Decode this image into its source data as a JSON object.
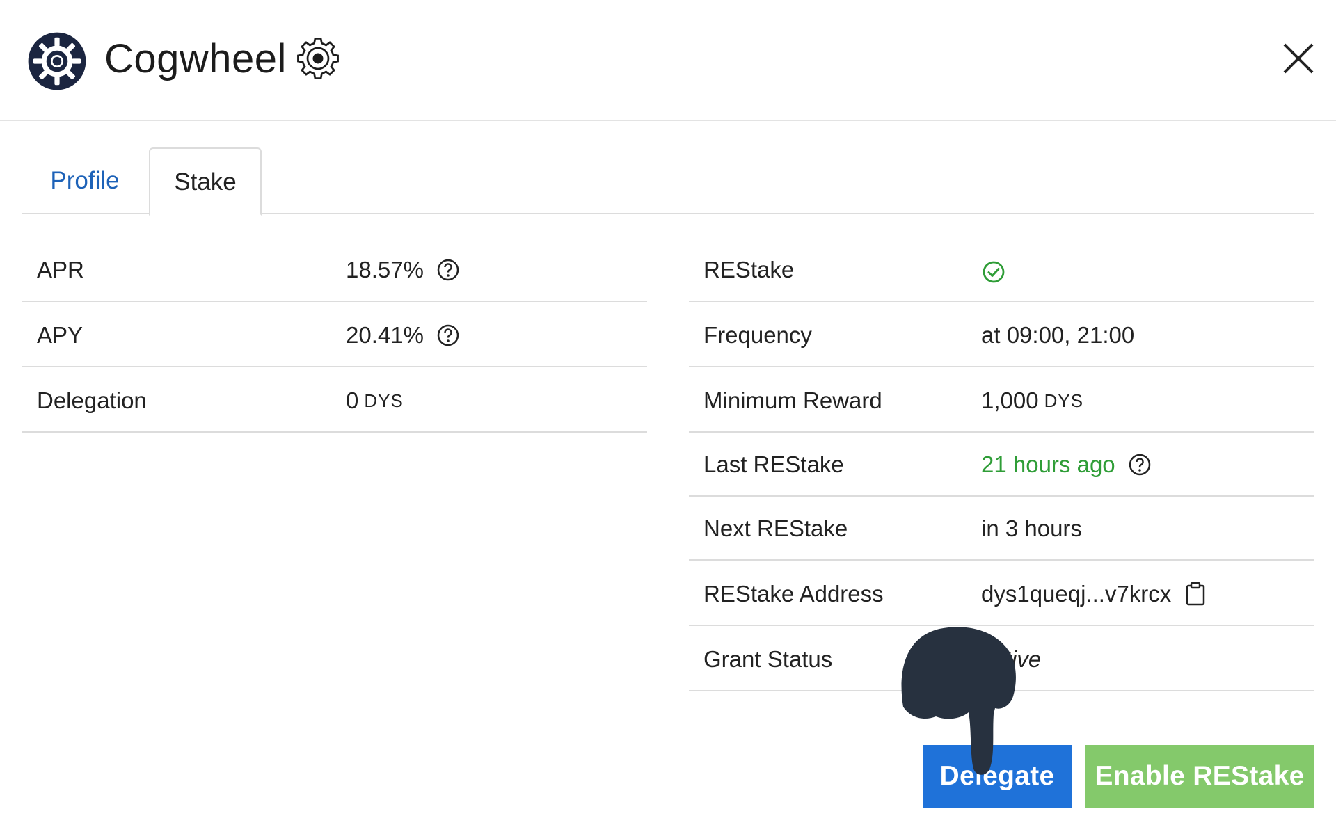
{
  "header": {
    "title": "Cogwheel"
  },
  "tabs": [
    {
      "label": "Profile",
      "active": false
    },
    {
      "label": "Stake",
      "active": true
    }
  ],
  "left_table": [
    {
      "label": "APR",
      "value": "18.57%"
    },
    {
      "label": "APY",
      "value": "20.41%"
    },
    {
      "label": "Delegation",
      "value": "0",
      "unit": "DYS"
    }
  ],
  "right_table": [
    {
      "label": "REStake",
      "value": ""
    },
    {
      "label": "Frequency",
      "value": "at 09:00, 21:00"
    },
    {
      "label": "Minimum Reward",
      "value": "1,000",
      "unit": "DYS"
    },
    {
      "label": "Last REStake",
      "value": "21 hours ago"
    },
    {
      "label": "Next REStake",
      "value": "in 3 hours"
    },
    {
      "label": "REStake Address",
      "value": "dys1queqj...v7krcx"
    },
    {
      "label": "Grant Status",
      "value": "active"
    }
  ],
  "buttons": {
    "delegate": "Delegate",
    "enable_restake": "Enable REStake"
  },
  "colors": {
    "primary": "#1f72d9",
    "success": "#84c96b",
    "link": "#1d62b8",
    "status_green": "#2f9d37",
    "logo": "#1b2540"
  }
}
